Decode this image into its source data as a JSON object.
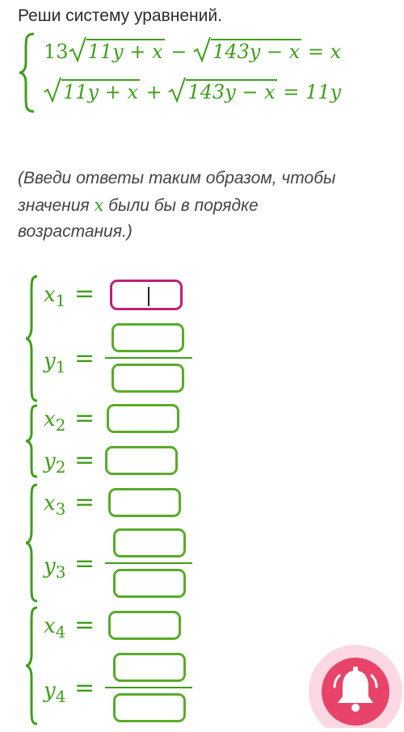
{
  "task": {
    "title": "Реши систему уравнений.",
    "system": {
      "line1": {
        "coef": "13",
        "rad1": "11y + x",
        "op": "−",
        "rad2": "143y − x",
        "rhs": "= x"
      },
      "line2": {
        "rad1": "11y + x",
        "op": "+",
        "rad2": "143y − x",
        "rhs": "= 11y"
      }
    },
    "hint": {
      "part1": "(Введи ответы таким образом, чтобы значения ",
      "var": "x",
      "part2": " были бы в порядке возрастания.)"
    }
  },
  "answers": [
    {
      "x_label": "x",
      "x_sub": "1",
      "y_label": "y",
      "y_sub": "1",
      "x_value": "",
      "y_numerator": "",
      "y_denominator": ""
    },
    {
      "x_label": "x",
      "x_sub": "2",
      "y_label": "y",
      "y_sub": "2",
      "x_value": "",
      "y_value": ""
    },
    {
      "x_label": "x",
      "x_sub": "3",
      "y_label": "y",
      "y_sub": "3",
      "x_value": "",
      "y_numerator": "",
      "y_denominator": ""
    },
    {
      "x_label": "x",
      "x_sub": "4",
      "y_label": "y",
      "y_sub": "4",
      "x_value": "",
      "y_numerator": "",
      "y_denominator": ""
    }
  ],
  "eq_sign": "=",
  "colors": {
    "math": "#3f9e1a",
    "box_border": "#5aab2a",
    "active_border": "#c0207a",
    "bell_bg": "#e8446a"
  },
  "icons": {
    "notification": "bell-icon"
  }
}
